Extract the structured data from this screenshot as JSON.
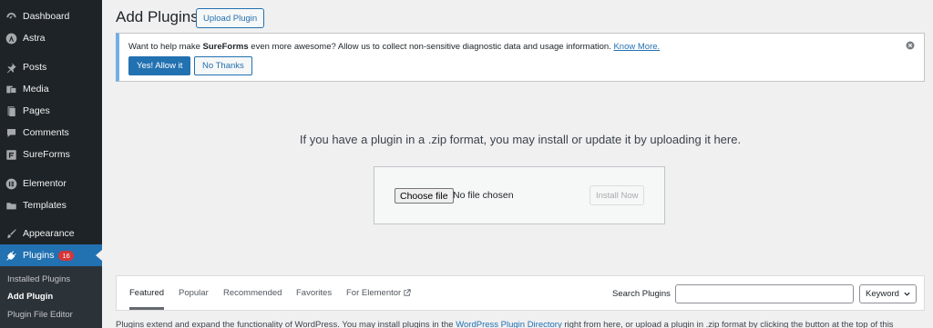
{
  "sidebar": {
    "items": [
      {
        "label": "Dashboard",
        "icon": "dashboard-icon"
      },
      {
        "label": "Astra",
        "icon": "astra-icon"
      },
      {
        "label": "Posts",
        "icon": "pin-icon"
      },
      {
        "label": "Media",
        "icon": "media-icon"
      },
      {
        "label": "Pages",
        "icon": "pages-icon"
      },
      {
        "label": "Comments",
        "icon": "comments-icon"
      },
      {
        "label": "SureForms",
        "icon": "sureforms-icon"
      },
      {
        "label": "Elementor",
        "icon": "elementor-icon"
      },
      {
        "label": "Templates",
        "icon": "folder-icon"
      },
      {
        "label": "Appearance",
        "icon": "brush-icon"
      },
      {
        "label": "Plugins",
        "icon": "plugin-icon",
        "badge": "16"
      }
    ],
    "submenu": [
      "Installed Plugins",
      "Add Plugin",
      "Plugin File Editor"
    ]
  },
  "header": {
    "title": "Add Plugins",
    "upload_label": "Upload Plugin"
  },
  "notice": {
    "text_before": "Want to help make ",
    "brand": "SureForms",
    "text_after": " even more awesome? Allow us to collect non-sensitive diagnostic data and usage information. ",
    "link": "Know More.",
    "allow_label": "Yes! Allow it",
    "decline_label": "No Thanks"
  },
  "upload": {
    "description": "If you have a plugin in a .zip format, you may install or update it by uploading it here.",
    "choose_label": "Choose file",
    "file_status": "No file chosen",
    "install_label": "Install Now"
  },
  "filters": {
    "tabs": [
      "Featured",
      "Popular",
      "Recommended",
      "Favorites",
      "For Elementor"
    ],
    "search_label": "Search Plugins",
    "search_value": "",
    "select_value": "Keyword"
  },
  "footer": {
    "text_before": "Plugins extend and expand the functionality of WordPress. You may install plugins in the ",
    "link": "WordPress Plugin Directory",
    "text_after": " right from here, or upload a plugin in .zip format by clicking the button at the top of this"
  },
  "colors": {
    "sidebar_bg": "#1d2327",
    "accent": "#2271b1",
    "badge": "#d63638",
    "notice_border": "#72aee6"
  }
}
